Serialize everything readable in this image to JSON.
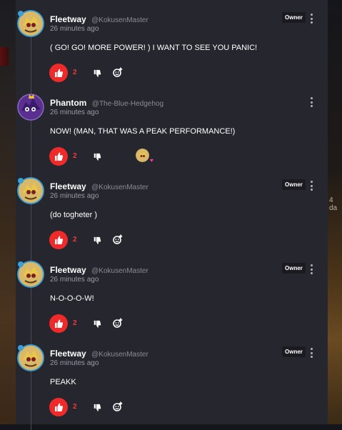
{
  "background": {
    "right_edge_text": "4 da"
  },
  "colors": {
    "panel": "#26262e",
    "like": "#ee2a2a",
    "like_count": "#ee3b3b",
    "heart": "#ff3fa0"
  },
  "comments": [
    {
      "author": "Fleetway",
      "handle": "@KokusenMaster",
      "time": "26 minutes ago",
      "badge": "Owner",
      "text": "( GO! GO! MORE POWER! ) I WANT TO SEE YOU PANIC!",
      "likes": "2",
      "avatar": "fleetway-avatar",
      "liked_by_owner": false
    },
    {
      "author": "Phantom",
      "handle": "@The-Blue-Hedgehog",
      "time": "26 minutes ago",
      "badge": "",
      "text": "NOW! (MAN, THAT WAS A PEAK PERFORMANCE!)",
      "likes": "2",
      "avatar": "phantom-avatar",
      "liked_by_owner": true,
      "heart": "♥"
    },
    {
      "author": "Fleetway",
      "handle": "@KokusenMaster",
      "time": "26 minutes ago",
      "badge": "Owner",
      "text": "(do togheter )",
      "likes": "2",
      "avatar": "fleetway-avatar",
      "liked_by_owner": false
    },
    {
      "author": "Fleetway",
      "handle": "@KokusenMaster",
      "time": "26 minutes ago",
      "badge": "Owner",
      "text": "N-O-O-O-W!",
      "likes": "2",
      "avatar": "fleetway-avatar",
      "liked_by_owner": false
    },
    {
      "author": "Fleetway",
      "handle": "@KokusenMaster",
      "time": "26 minutes ago",
      "badge": "Owner",
      "text": "PEAKK",
      "likes": "2",
      "avatar": "fleetway-avatar",
      "liked_by_owner": false
    }
  ]
}
